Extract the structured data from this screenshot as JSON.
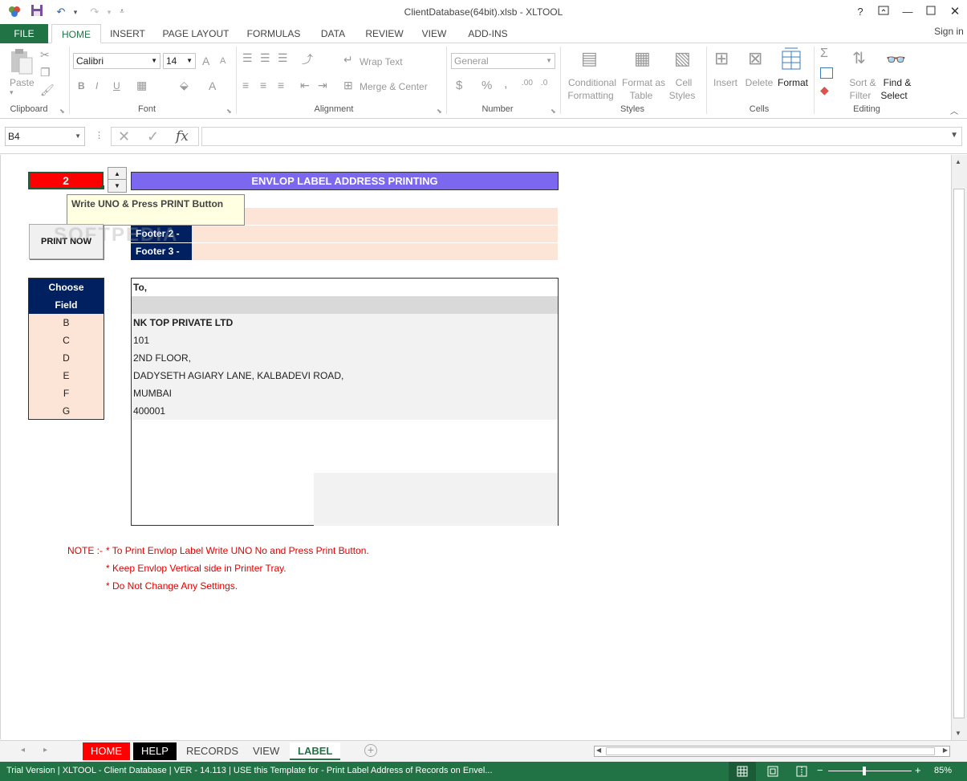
{
  "window": {
    "title": "ClientDatabase(64bit).xlsb - XLTOOL",
    "help": "?",
    "sign_in": "Sign in"
  },
  "ribbon_tabs": [
    "FILE",
    "HOME",
    "INSERT",
    "PAGE LAYOUT",
    "FORMULAS",
    "DATA",
    "REVIEW",
    "VIEW",
    "ADD-INS"
  ],
  "ribbon": {
    "clipboard": {
      "paste": "Paste",
      "label": "Clipboard"
    },
    "font": {
      "name": "Calibri",
      "size": "14",
      "label": "Font",
      "bold": "B",
      "italic": "I",
      "underline": "U",
      "grow": "A",
      "shrink": "A",
      "color": "A"
    },
    "alignment": {
      "wrap": "Wrap Text",
      "merge": "Merge & Center",
      "label": "Alignment"
    },
    "number": {
      "format": "General",
      "currency": "$",
      "percent": "%",
      "comma": ",",
      "label": "Number"
    },
    "styles": {
      "conditional": "Conditional",
      "conditional2": "Formatting",
      "format_as": "Format as",
      "format_as2": "Table",
      "cell": "Cell",
      "cell2": "Styles",
      "label": "Styles"
    },
    "cells": {
      "insert": "Insert",
      "delete": "Delete",
      "format": "Format",
      "label": "Cells"
    },
    "editing": {
      "sort": "Sort &",
      "sort2": "Filter",
      "find": "Find &",
      "find2": "Select",
      "label": "Editing"
    }
  },
  "formula_bar": {
    "name_box": "B4",
    "fx": "fx",
    "value": ""
  },
  "sheet": {
    "uno_value": "2",
    "banner": "ENVLOP LABEL ADDRESS PRINTING",
    "tooltip": "Write UNO & Press PRINT Button",
    "print_button": "PRINT NOW",
    "footer2": "Footer 2 -",
    "footer3": "Footer 3 -",
    "choose_field_1": "Choose",
    "choose_field_2": "Field",
    "fields": [
      "B",
      "C",
      "D",
      "E",
      "F",
      "G"
    ],
    "label_to": "To,",
    "address_lines": [
      "NK TOP PRIVATE LTD",
      "101",
      "2ND FLOOR,",
      "DADYSETH AGIARY LANE, KALBADEVI ROAD,",
      "MUMBAI",
      "400001"
    ],
    "note_prefix": "NOTE :-",
    "notes": [
      "* To Print Envlop Label Write UNO No and Press Print Button.",
      "* Keep Envlop Vertical side in Printer Tray.",
      "* Do Not Change Any Settings."
    ],
    "watermark": "SOFTPEDIA"
  },
  "sheet_tabs": [
    {
      "label": "HOME",
      "bg": "#ff0000",
      "fg": "#ffffff"
    },
    {
      "label": "HELP",
      "bg": "#000000",
      "fg": "#ffffff"
    },
    {
      "label": "RECORDS",
      "bg": "#f3f3f3",
      "fg": "#444444"
    },
    {
      "label": "VIEW",
      "bg": "#f3f3f3",
      "fg": "#444444"
    },
    {
      "label": "LABEL",
      "bg": "#ffffff",
      "fg": "#217346"
    }
  ],
  "status_bar": {
    "text": "Trial Version  | XLTOOL - Client Database  | VER - 14.113  | USE this Template for - Print Label Address of Records on Envel...",
    "zoom": "85%",
    "minus": "−",
    "plus": "+"
  },
  "colors": {
    "excel_green": "#217346",
    "banner_blue": "#7b68ee",
    "navy": "#002060",
    "peach": "#fce4d6",
    "uno_red": "#ff0000",
    "note_red": "#e00000"
  }
}
